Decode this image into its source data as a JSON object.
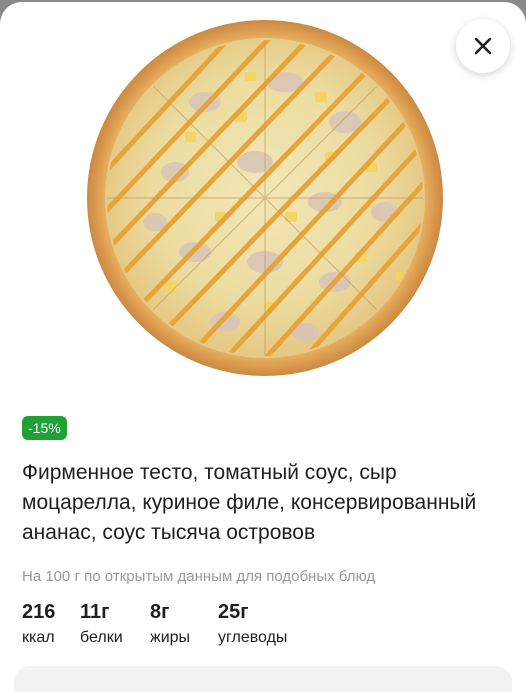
{
  "close": {
    "icon": "close-icon"
  },
  "product": {
    "image": "pizza-photo",
    "discount_badge": "-15%",
    "description": "Фирменное тесто, томатный соус, сыр моцарелла, куриное филе, консервированный ананас, соус тысяча островов"
  },
  "nutrition": {
    "source_note": "На 100 г по открытым данным для подобных блюд",
    "items": [
      {
        "value": "216",
        "label": "ккал"
      },
      {
        "value": "11г",
        "label": "белки"
      },
      {
        "value": "8г",
        "label": "жиры"
      },
      {
        "value": "25г",
        "label": "углеводы"
      }
    ]
  },
  "colors": {
    "badge": "#21a038",
    "overlay": "#8a8a8a",
    "sheet": "#ffffff"
  }
}
